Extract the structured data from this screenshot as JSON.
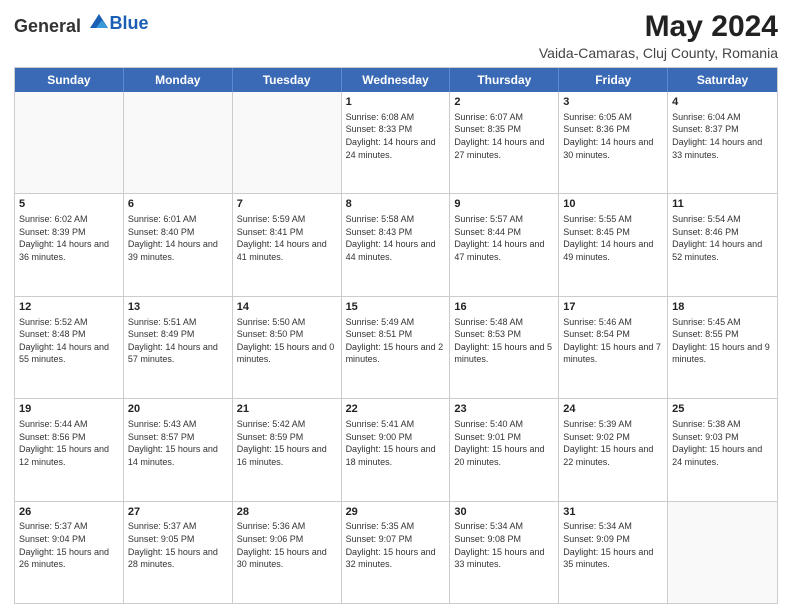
{
  "logo": {
    "general": "General",
    "blue": "Blue"
  },
  "header": {
    "month_year": "May 2024",
    "location": "Vaida-Camaras, Cluj County, Romania"
  },
  "days_of_week": [
    "Sunday",
    "Monday",
    "Tuesday",
    "Wednesday",
    "Thursday",
    "Friday",
    "Saturday"
  ],
  "rows": [
    [
      {
        "day": "",
        "empty": true
      },
      {
        "day": "",
        "empty": true
      },
      {
        "day": "",
        "empty": true
      },
      {
        "day": "1",
        "sunrise": "6:08 AM",
        "sunset": "8:33 PM",
        "daylight": "14 hours and 24 minutes."
      },
      {
        "day": "2",
        "sunrise": "6:07 AM",
        "sunset": "8:35 PM",
        "daylight": "14 hours and 27 minutes."
      },
      {
        "day": "3",
        "sunrise": "6:05 AM",
        "sunset": "8:36 PM",
        "daylight": "14 hours and 30 minutes."
      },
      {
        "day": "4",
        "sunrise": "6:04 AM",
        "sunset": "8:37 PM",
        "daylight": "14 hours and 33 minutes."
      }
    ],
    [
      {
        "day": "5",
        "sunrise": "6:02 AM",
        "sunset": "8:39 PM",
        "daylight": "14 hours and 36 minutes."
      },
      {
        "day": "6",
        "sunrise": "6:01 AM",
        "sunset": "8:40 PM",
        "daylight": "14 hours and 39 minutes."
      },
      {
        "day": "7",
        "sunrise": "5:59 AM",
        "sunset": "8:41 PM",
        "daylight": "14 hours and 41 minutes."
      },
      {
        "day": "8",
        "sunrise": "5:58 AM",
        "sunset": "8:43 PM",
        "daylight": "14 hours and 44 minutes."
      },
      {
        "day": "9",
        "sunrise": "5:57 AM",
        "sunset": "8:44 PM",
        "daylight": "14 hours and 47 minutes."
      },
      {
        "day": "10",
        "sunrise": "5:55 AM",
        "sunset": "8:45 PM",
        "daylight": "14 hours and 49 minutes."
      },
      {
        "day": "11",
        "sunrise": "5:54 AM",
        "sunset": "8:46 PM",
        "daylight": "14 hours and 52 minutes."
      }
    ],
    [
      {
        "day": "12",
        "sunrise": "5:52 AM",
        "sunset": "8:48 PM",
        "daylight": "14 hours and 55 minutes."
      },
      {
        "day": "13",
        "sunrise": "5:51 AM",
        "sunset": "8:49 PM",
        "daylight": "14 hours and 57 minutes."
      },
      {
        "day": "14",
        "sunrise": "5:50 AM",
        "sunset": "8:50 PM",
        "daylight": "15 hours and 0 minutes."
      },
      {
        "day": "15",
        "sunrise": "5:49 AM",
        "sunset": "8:51 PM",
        "daylight": "15 hours and 2 minutes."
      },
      {
        "day": "16",
        "sunrise": "5:48 AM",
        "sunset": "8:53 PM",
        "daylight": "15 hours and 5 minutes."
      },
      {
        "day": "17",
        "sunrise": "5:46 AM",
        "sunset": "8:54 PM",
        "daylight": "15 hours and 7 minutes."
      },
      {
        "day": "18",
        "sunrise": "5:45 AM",
        "sunset": "8:55 PM",
        "daylight": "15 hours and 9 minutes."
      }
    ],
    [
      {
        "day": "19",
        "sunrise": "5:44 AM",
        "sunset": "8:56 PM",
        "daylight": "15 hours and 12 minutes."
      },
      {
        "day": "20",
        "sunrise": "5:43 AM",
        "sunset": "8:57 PM",
        "daylight": "15 hours and 14 minutes."
      },
      {
        "day": "21",
        "sunrise": "5:42 AM",
        "sunset": "8:59 PM",
        "daylight": "15 hours and 16 minutes."
      },
      {
        "day": "22",
        "sunrise": "5:41 AM",
        "sunset": "9:00 PM",
        "daylight": "15 hours and 18 minutes."
      },
      {
        "day": "23",
        "sunrise": "5:40 AM",
        "sunset": "9:01 PM",
        "daylight": "15 hours and 20 minutes."
      },
      {
        "day": "24",
        "sunrise": "5:39 AM",
        "sunset": "9:02 PM",
        "daylight": "15 hours and 22 minutes."
      },
      {
        "day": "25",
        "sunrise": "5:38 AM",
        "sunset": "9:03 PM",
        "daylight": "15 hours and 24 minutes."
      }
    ],
    [
      {
        "day": "26",
        "sunrise": "5:37 AM",
        "sunset": "9:04 PM",
        "daylight": "15 hours and 26 minutes."
      },
      {
        "day": "27",
        "sunrise": "5:37 AM",
        "sunset": "9:05 PM",
        "daylight": "15 hours and 28 minutes."
      },
      {
        "day": "28",
        "sunrise": "5:36 AM",
        "sunset": "9:06 PM",
        "daylight": "15 hours and 30 minutes."
      },
      {
        "day": "29",
        "sunrise": "5:35 AM",
        "sunset": "9:07 PM",
        "daylight": "15 hours and 32 minutes."
      },
      {
        "day": "30",
        "sunrise": "5:34 AM",
        "sunset": "9:08 PM",
        "daylight": "15 hours and 33 minutes."
      },
      {
        "day": "31",
        "sunrise": "5:34 AM",
        "sunset": "9:09 PM",
        "daylight": "15 hours and 35 minutes."
      },
      {
        "day": "",
        "empty": true
      }
    ]
  ]
}
